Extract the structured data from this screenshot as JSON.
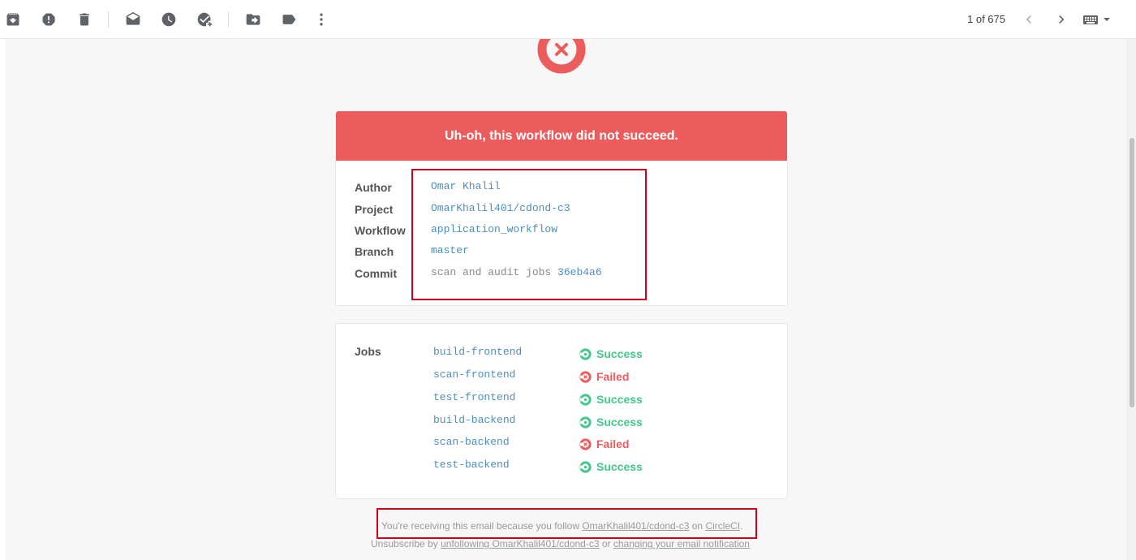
{
  "toolbar": {
    "icons": [
      "archive-icon",
      "report-spam-icon",
      "delete-icon",
      "mark-read-icon",
      "snooze-icon",
      "add-task-icon",
      "move-to-icon",
      "label-icon",
      "more-options-icon"
    ],
    "pager": "1 of 675"
  },
  "email": {
    "banner": "Uh-oh, this workflow did not succeed.",
    "details": {
      "author_label": "Author",
      "author_value": "Omar Khalil",
      "project_label": "Project",
      "project_value": "OmarKhalil401/cdond-c3",
      "workflow_label": "Workflow",
      "workflow_value": "application_workflow",
      "branch_label": "Branch",
      "branch_value": "master",
      "commit_label": "Commit",
      "commit_message": "scan and audit jobs",
      "commit_hash": "36eb4a6"
    },
    "jobs": {
      "label": "Jobs",
      "items": [
        {
          "name": "build-frontend",
          "status": "Success"
        },
        {
          "name": "scan-frontend",
          "status": "Failed"
        },
        {
          "name": "test-frontend",
          "status": "Success"
        },
        {
          "name": "build-backend",
          "status": "Success"
        },
        {
          "name": "scan-backend",
          "status": "Failed"
        },
        {
          "name": "test-backend",
          "status": "Success"
        }
      ]
    },
    "footer": {
      "line1_pre": "You're receiving this email because you follow",
      "line1_link": "OmarKhalil401/cdond-c3",
      "line1_mid": "on",
      "line1_link2": "CircleCI",
      "line1_post": ".",
      "line2_pre": "Unsubscribe by",
      "line2_link": "unfollowing OmarKhalil401/cdond-c3",
      "line2_mid": "or",
      "line2_link2": "changing your email notification"
    }
  },
  "colors": {
    "failure_red": "#ed5c5c",
    "success_green": "#42c88a",
    "link_blue": "#4b8fbf",
    "highlight_box": "#d0021b"
  }
}
